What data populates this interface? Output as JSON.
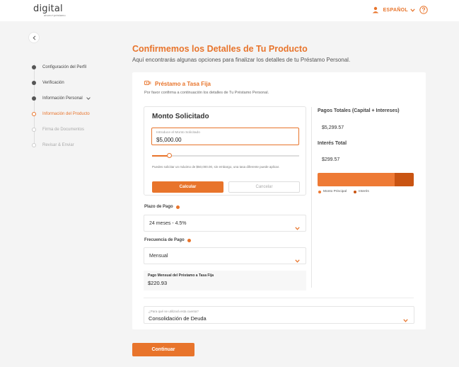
{
  "header": {
    "logo": "digital",
    "logo_sub": "ahorro+préstamo",
    "language": "ESPAÑOL"
  },
  "steps": [
    {
      "label": "Configuración del Perfil",
      "status": "done"
    },
    {
      "label": "Verificación",
      "status": "done"
    },
    {
      "label": "Información Personal",
      "status": "done"
    },
    {
      "label": "Información del Producto",
      "status": "active"
    },
    {
      "label": "Firma de Documentos",
      "status": "pending"
    },
    {
      "label": "Revisar & Enviar",
      "status": "pending"
    }
  ],
  "page": {
    "title": "Confirmemos los Detalles de Tu Producto",
    "subtitle": "Aquí encontrarás algunas opciones para finalizar los detalles de tu Préstamo Personal."
  },
  "card": {
    "title": "Préstamo a Tasa Fija",
    "description": "Por favor confirma a continuación los detalles de Tu Préstamo Personal."
  },
  "amount": {
    "title": "Monto Solicitado",
    "field_label": "Introduce el Monto Solicitado",
    "value": "$5,000.00",
    "slider_fraction": 0.12,
    "note": "Puedes solicitar un máximo de $50,000.00, sin embargo, una tasa diferente puede aplicar.",
    "calc_label": "Calcular",
    "cancel_label": "Cancelar"
  },
  "term": {
    "label": "Plazo de Pago",
    "value": "24 meses - 4.5%"
  },
  "frequency": {
    "label": "Frecuencia de Pago",
    "value": "Mensual"
  },
  "payment": {
    "label": "Pago Mensual del Préstamo a Tasa Fija",
    "value": "$220.93"
  },
  "totals": {
    "total_label": "Pagos Totales (Capital + Intereses)",
    "total_value": "$5,299.57",
    "interest_label": "Interés Total",
    "interest_value": "$299.57",
    "principal_amount": 5000,
    "interest_amount": 299.57,
    "legend_principal": "Monto Principal",
    "legend_interest": "Interés",
    "color_principal": "#ee7a35",
    "color_interest": "#c95412"
  },
  "purpose": {
    "label": "¿Para qué se utilizará esta cuenta?",
    "value": "Consolidación de Deuda"
  },
  "continue_label": "Continuar"
}
